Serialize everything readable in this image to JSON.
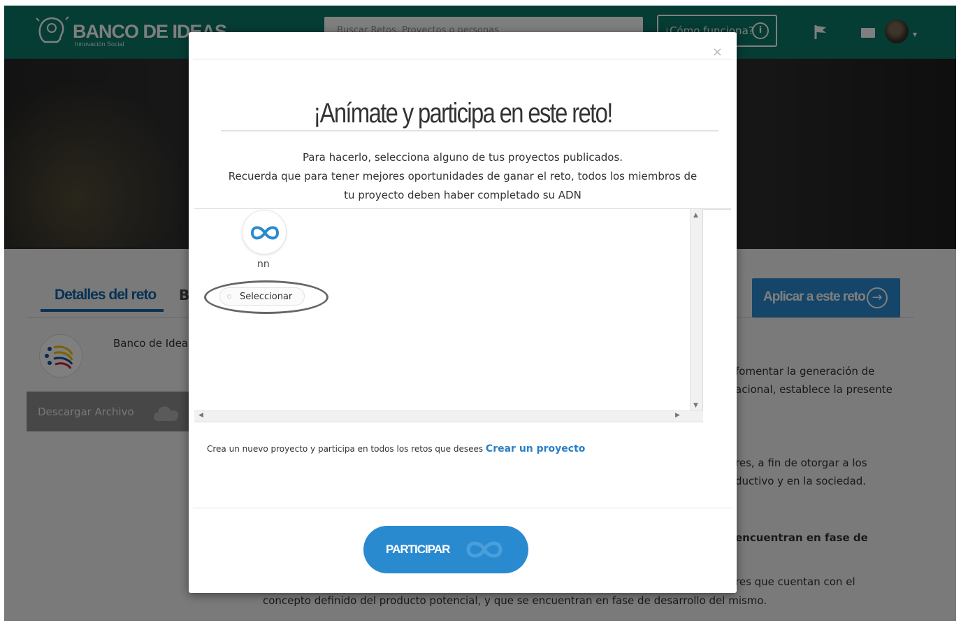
{
  "header": {
    "brand": "BANCO DE IDEAS",
    "brand_sub": "Innovación Social",
    "search_placeholder": "Buscar Retos, Proyectos o personas",
    "how_it_works": "¿Cómo funciona?",
    "info_icon": "info-icon",
    "flag_icon": "flag-icon",
    "mail_icon": "mail-icon"
  },
  "page": {
    "tab_active": "Detalles del reto",
    "tab_other_initial": "B",
    "apply_button": "Aplicar a este reto",
    "org_name": "Banco de Ideas",
    "download_button": "Descargar Archivo",
    "paragraph_fragments": [
      "fomentar la generación de",
      "acional, establece la presente",
      "res, a fin de otorgar a los",
      "ductivo y en la sociedad.",
      "encuentran en fase de",
      "res que cuentan con el",
      "concepto definido del producto potencial, y que se encuentran en fase de desarrollo del mismo."
    ]
  },
  "modal": {
    "close": "×",
    "title": "¡Anímate y participa en este reto!",
    "desc_line1": "Para hacerlo, selecciona alguno de tus proyectos publicados.",
    "desc_line2": "Recuerda que para tener mejores oportunidades de ganar el reto, todos los miembros de",
    "desc_line3": "tu proyecto deben haber completado su ADN",
    "project": {
      "name": "nn",
      "select_label": "Seleccionar",
      "icon": "infinity-icon"
    },
    "create_text": "Crea un nuevo proyecto y participa en todos los retos que desees ",
    "create_link": "Crear un proyecto",
    "participate_button": "PARTICIPAR"
  },
  "colors": {
    "topbar": "#0a7868",
    "primary_blue": "#2a8ad0",
    "tab_blue": "#1565a8",
    "link_blue": "#2a7fc6"
  }
}
